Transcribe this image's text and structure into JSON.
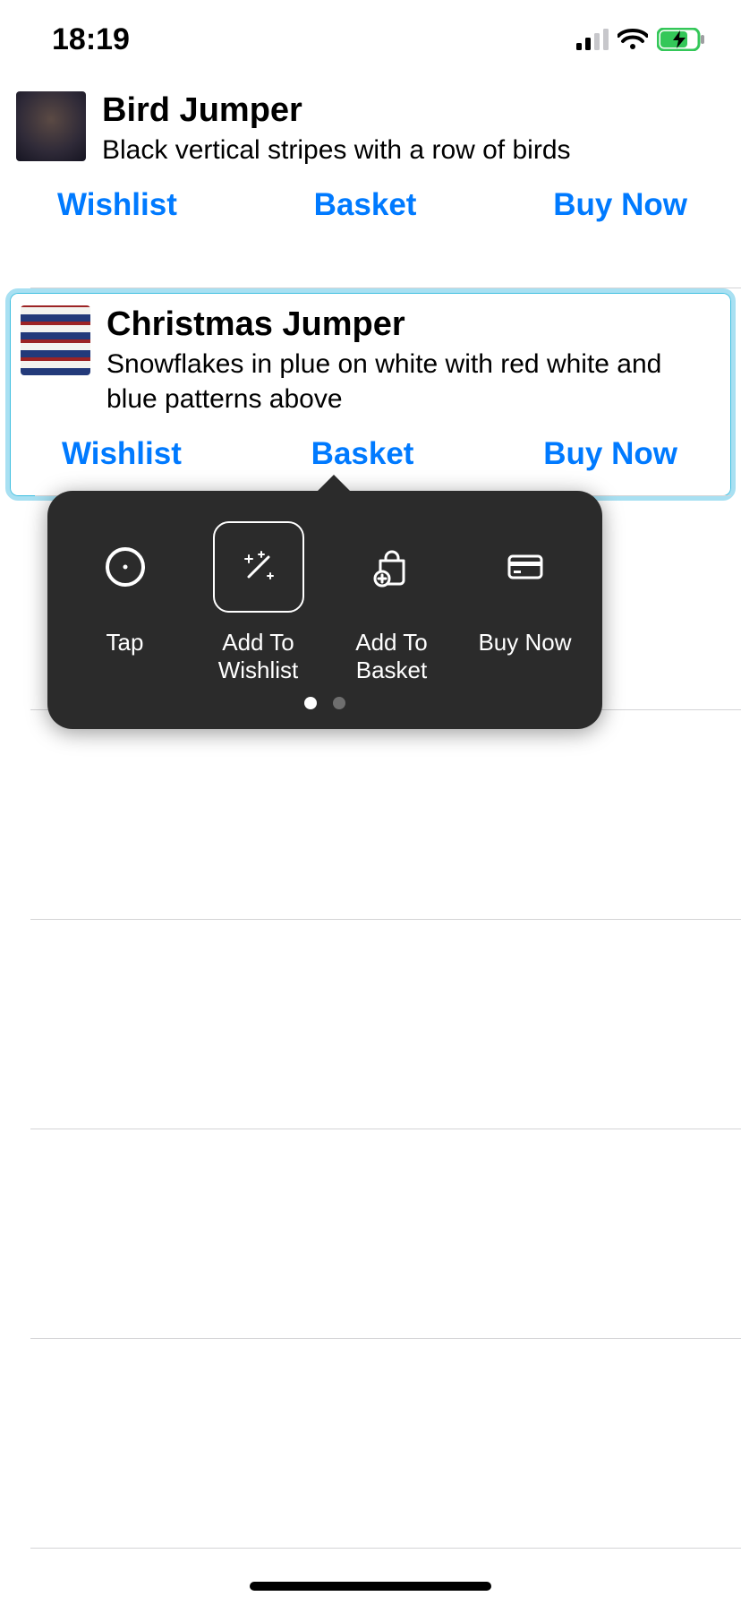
{
  "status_bar": {
    "time": "18:19"
  },
  "action_labels": {
    "wishlist": "Wishlist",
    "basket": "Basket",
    "buy_now": "Buy Now"
  },
  "products": {
    "item0": {
      "title": "Bird Jumper",
      "desc": "Black vertical stripes with a row of birds"
    },
    "item1": {
      "title": "Christmas Jumper",
      "desc": "Snowflakes in plue on white with red white and blue patterns above"
    }
  },
  "popup": {
    "tap": "Tap",
    "wishlist": "Add To Wishlist",
    "basket": "Add To Basket",
    "buy": "Buy Now"
  }
}
